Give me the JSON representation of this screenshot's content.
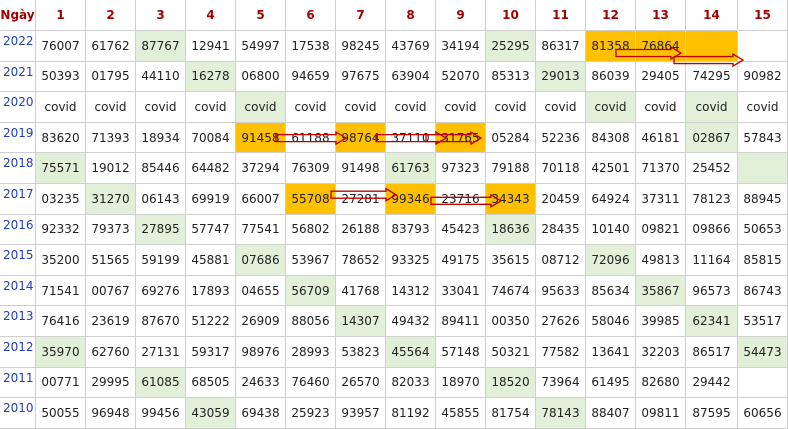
{
  "colors": {
    "green": "#e2f0d9",
    "orange": "#ffc000",
    "header_text": "#a40000",
    "year_text": "#1f3fbf",
    "arrow": "#c00000"
  },
  "corner_label": "Ngày",
  "columns": [
    "1",
    "2",
    "3",
    "4",
    "5",
    "6",
    "7",
    "8",
    "9",
    "10",
    "11",
    "12",
    "13",
    "14",
    "15"
  ],
  "rows": [
    {
      "year": "2022",
      "cells": [
        "76007",
        "61762",
        "87767",
        "12941",
        "54997",
        "17538",
        "98245",
        "43769",
        "34194",
        "25295",
        "86317",
        "81358",
        "76864",
        "",
        ""
      ],
      "marks": [
        "",
        "",
        "g",
        "",
        "",
        "",
        "",
        "",
        "",
        "g",
        "",
        "o",
        "o",
        "o",
        ""
      ]
    },
    {
      "year": "2021",
      "cells": [
        "50393",
        "01795",
        "44110",
        "16278",
        "06800",
        "94659",
        "97675",
        "63904",
        "52070",
        "85313",
        "29013",
        "86039",
        "29405",
        "74295",
        "90982"
      ],
      "marks": [
        "",
        "",
        "",
        "g",
        "",
        "",
        "",
        "",
        "",
        "",
        "g",
        "",
        "",
        "",
        ""
      ]
    },
    {
      "year": "2020",
      "cells": [
        "covid",
        "covid",
        "covid",
        "covid",
        "covid",
        "covid",
        "covid",
        "covid",
        "covid",
        "covid",
        "covid",
        "covid",
        "covid",
        "covid",
        "covid"
      ],
      "marks": [
        "",
        "",
        "",
        "",
        "g",
        "",
        "",
        "",
        "",
        "",
        "",
        "g",
        "",
        "g",
        ""
      ]
    },
    {
      "year": "2019",
      "cells": [
        "83620",
        "71393",
        "18934",
        "70084",
        "91458",
        "61188",
        "98764",
        "37110",
        "31765",
        "05284",
        "52236",
        "84308",
        "46181",
        "02867",
        "57843"
      ],
      "marks": [
        "",
        "",
        "",
        "",
        "o",
        "",
        "o",
        "",
        "o",
        "",
        "",
        "",
        "",
        "g",
        ""
      ]
    },
    {
      "year": "2018",
      "cells": [
        "75571",
        "19012",
        "85446",
        "64482",
        "37294",
        "76309",
        "91498",
        "61763",
        "97323",
        "79188",
        "70118",
        "42501",
        "71370",
        "25452",
        ""
      ],
      "marks": [
        "g",
        "",
        "",
        "",
        "",
        "",
        "",
        "g",
        "",
        "",
        "",
        "",
        "",
        "",
        "g"
      ],
      "shift_last": true
    },
    {
      "year": "2017",
      "cells": [
        "03235",
        "31270",
        "06143",
        "69919",
        "66007",
        "55708",
        "27281",
        "99346",
        "23716",
        "34343",
        "20459",
        "64924",
        "37311",
        "78123",
        "88945"
      ],
      "marks": [
        "",
        "g",
        "",
        "",
        "",
        "o",
        "",
        "o",
        "",
        "o",
        "",
        "",
        "",
        "",
        ""
      ]
    },
    {
      "year": "2016",
      "cells": [
        "92332",
        "79373",
        "27895",
        "57747",
        "77541",
        "56802",
        "26188",
        "83793",
        "45423",
        "18636",
        "28435",
        "10140",
        "09821",
        "09866",
        "50653"
      ],
      "marks": [
        "",
        "",
        "g",
        "",
        "",
        "",
        "",
        "",
        "",
        "g",
        "",
        "",
        "",
        "",
        ""
      ]
    },
    {
      "year": "2015",
      "cells": [
        "35200",
        "51565",
        "59199",
        "45881",
        "07686",
        "53967",
        "78652",
        "93325",
        "49175",
        "35615",
        "08712",
        "72096",
        "49813",
        "11164",
        "85815"
      ],
      "marks": [
        "",
        "",
        "",
        "",
        "g",
        "",
        "",
        "",
        "",
        "",
        "",
        "g",
        "",
        "",
        ""
      ]
    },
    {
      "year": "2014",
      "cells": [
        "71541",
        "00767",
        "69276",
        "17893",
        "04655",
        "56709",
        "41768",
        "14312",
        "33041",
        "74674",
        "95633",
        "85634",
        "35867",
        "96573",
        "86743"
      ],
      "marks": [
        "",
        "",
        "",
        "",
        "",
        "g",
        "",
        "",
        "",
        "",
        "",
        "",
        "g",
        "",
        ""
      ]
    },
    {
      "year": "2013",
      "cells": [
        "76416",
        "23619",
        "87670",
        "51222",
        "26909",
        "88056",
        "14307",
        "49432",
        "89411",
        "00350",
        "27626",
        "58046",
        "39985",
        "62341",
        "53517"
      ],
      "marks": [
        "",
        "",
        "",
        "",
        "",
        "",
        "g",
        "",
        "",
        "",
        "",
        "",
        "",
        "g",
        ""
      ]
    },
    {
      "year": "2012",
      "cells": [
        "35970",
        "62760",
        "27131",
        "59317",
        "98976",
        "28993",
        "53823",
        "45564",
        "57148",
        "50321",
        "77582",
        "13641",
        "32203",
        "86517",
        "54473"
      ],
      "marks": [
        "g",
        "",
        "",
        "",
        "",
        "",
        "",
        "g",
        "",
        "",
        "",
        "",
        "",
        "",
        "g"
      ]
    },
    {
      "year": "2011",
      "cells": [
        "00771",
        "29995",
        "61085",
        "68505",
        "24633",
        "76460",
        "26570",
        "82033",
        "18970",
        "18520",
        "73964",
        "61495",
        "82680",
        "29442",
        ""
      ],
      "marks": [
        "",
        "",
        "g",
        "",
        "",
        "",
        "",
        "",
        "",
        "g",
        "",
        "",
        "",
        "",
        ""
      ],
      "shift_last": true
    },
    {
      "year": "2010",
      "cells": [
        "50055",
        "96948",
        "99456",
        "43059",
        "69438",
        "25923",
        "93957",
        "81192",
        "45855",
        "81754",
        "78143",
        "88407",
        "09811",
        "87595",
        "60656"
      ],
      "marks": [
        "",
        "",
        "",
        "g",
        "",
        "",
        "",
        "",
        "",
        "",
        "g",
        "",
        "",
        "",
        ""
      ]
    }
  ]
}
